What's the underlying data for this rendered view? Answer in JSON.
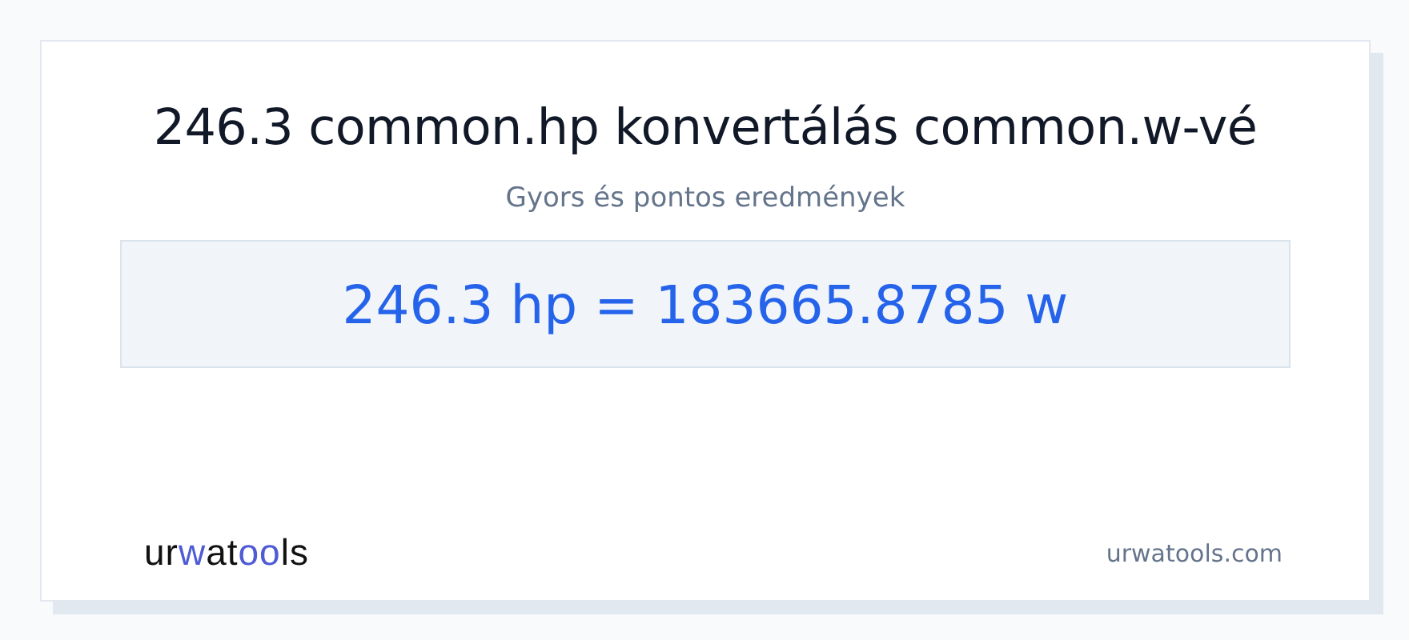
{
  "title": "246.3 common.hp konvertálás common.w-vé",
  "subtitle": "Gyors és pontos eredmények",
  "result": "246.3 hp = 183665.8785 w",
  "logo": [
    {
      "text": "ur",
      "accent": false
    },
    {
      "text": "w",
      "accent": true
    },
    {
      "text": "at",
      "accent": false
    },
    {
      "text": "oo",
      "accent": true
    },
    {
      "text": "ls",
      "accent": false
    }
  ],
  "site": "urwatools.com"
}
